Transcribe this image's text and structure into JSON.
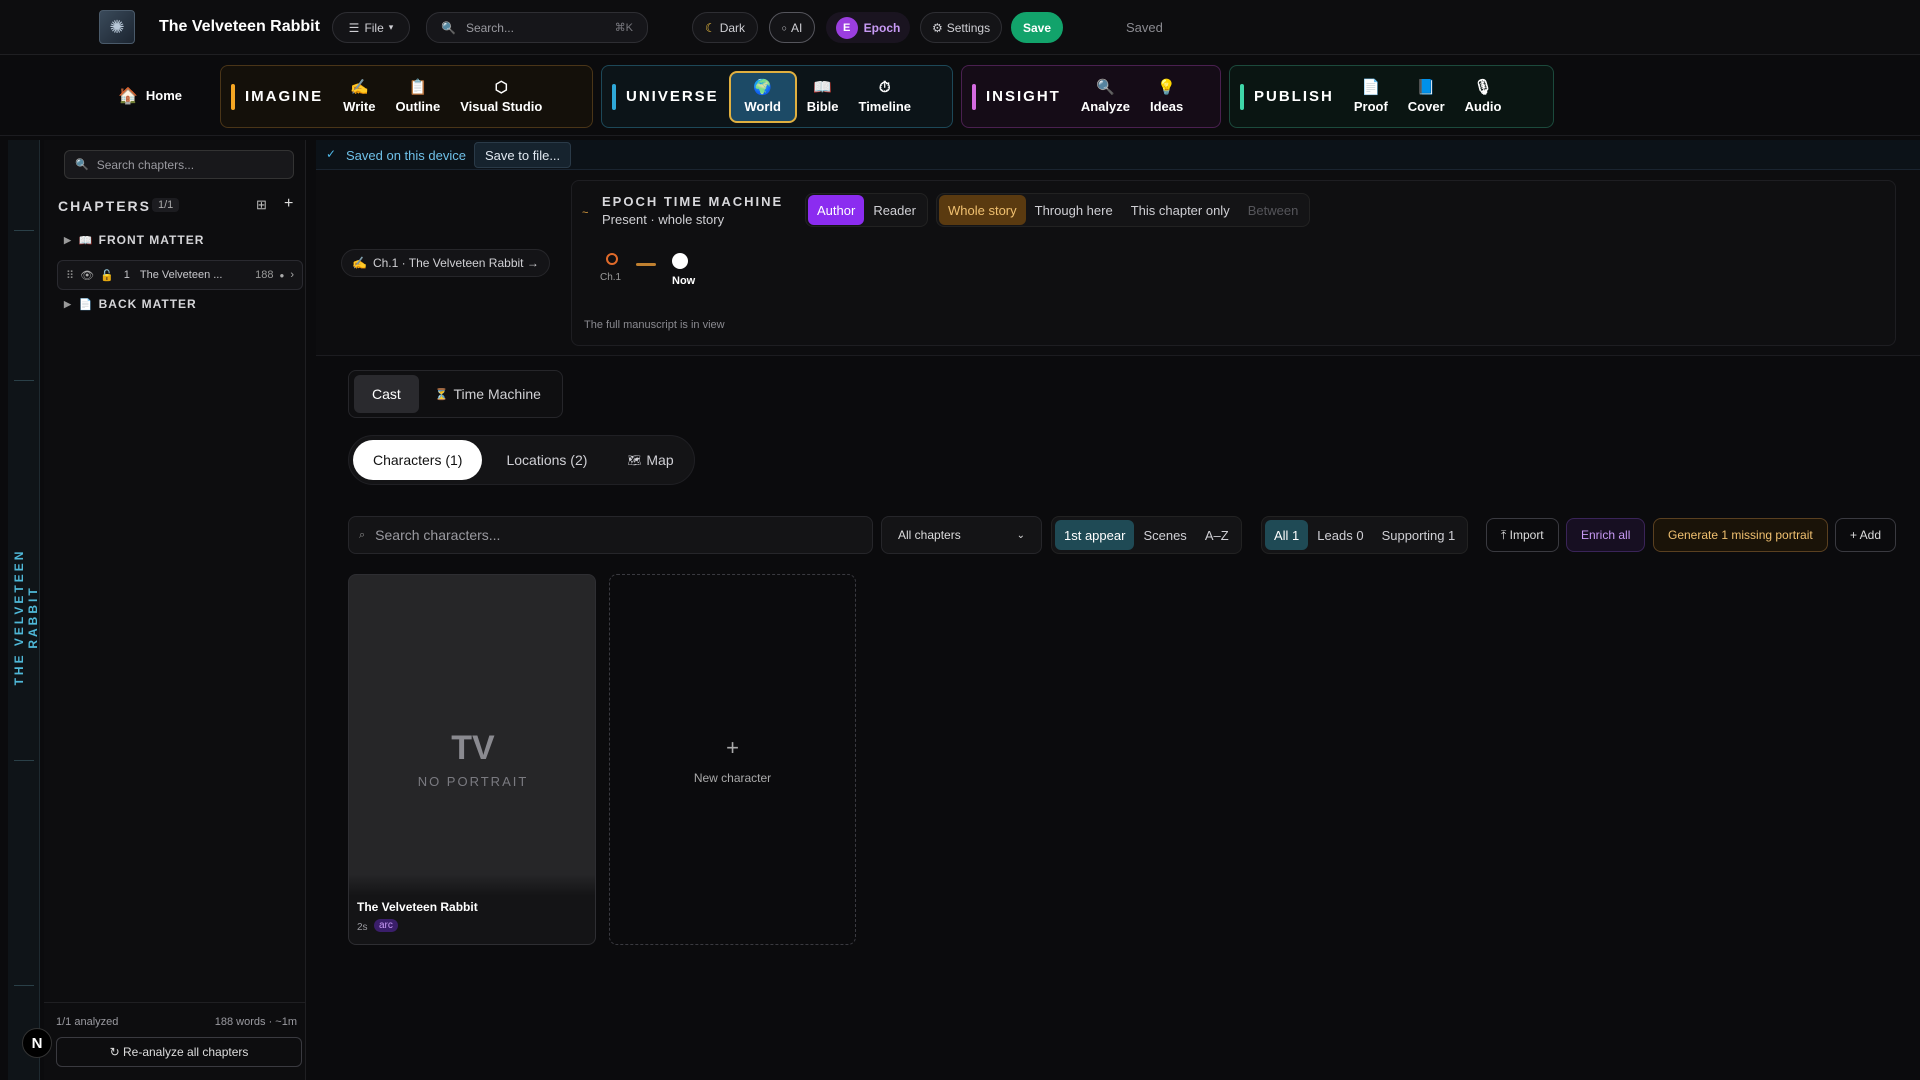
{
  "topbar": {
    "title": "The Velveteen Rabbit",
    "file_label": "File",
    "search_placeholder": "Search...",
    "search_shortcut": "⌘K",
    "dark_label": "Dark",
    "ai_label": "AI",
    "epoch_badge": "E",
    "epoch_label": "Epoch",
    "settings_label": "Settings",
    "save_label": "Save",
    "status": "Saved"
  },
  "nav": {
    "home": "Home",
    "groups": [
      {
        "name": "IMAGINE",
        "color": "#f5a623",
        "items": [
          {
            "icon": "✍",
            "label": "Write"
          },
          {
            "icon": "📋",
            "label": "Outline"
          },
          {
            "icon": "⬡",
            "label": "Visual Studio"
          }
        ]
      },
      {
        "name": "UNIVERSE",
        "color": "#2fa8d8",
        "items": [
          {
            "icon": "🌍",
            "label": "World"
          },
          {
            "icon": "📖",
            "label": "Bible"
          },
          {
            "icon": "⏱",
            "label": "Timeline"
          }
        ]
      },
      {
        "name": "INSIGHT",
        "color": "#d46be0",
        "items": [
          {
            "icon": "🔍",
            "label": "Analyze"
          },
          {
            "icon": "💡",
            "label": "Ideas"
          }
        ]
      },
      {
        "name": "PUBLISH",
        "color": "#3fd6a8",
        "items": [
          {
            "icon": "📄",
            "label": "Proof"
          },
          {
            "icon": "📘",
            "label": "Cover"
          },
          {
            "icon": "🎙",
            "label": "Audio"
          }
        ]
      }
    ]
  },
  "rail": {
    "label": "THE VELVETEEN RABBIT"
  },
  "sidebar": {
    "search_placeholder": "Search chapters...",
    "chapters_title": "CHAPTERS",
    "chapters_count": "1/1",
    "front_matter": "FRONT MATTER",
    "chapter": {
      "number": "1",
      "title": "The Velveteen ...",
      "words": "188"
    },
    "back_matter": "BACK MATTER",
    "analyzed": "1/1 analyzed",
    "words_time": "188 words · ~1m",
    "reanalyze": "↻ Re-analyze all chapters",
    "avatar": "N"
  },
  "savebar": {
    "saved_text": "Saved on this device",
    "save_to_file": "Save to file..."
  },
  "time_machine": {
    "chapter_chip": "Ch.1 · The Velveteen Rabbit →",
    "title": "EPOCH TIME MACHINE",
    "subtitle": "Present · whole story",
    "modes": [
      "Author",
      "Reader"
    ],
    "ranges": [
      "Whole story",
      "Through here",
      "This chapter only",
      "Between"
    ],
    "timeline_start": "Ch.1",
    "timeline_now": "Now",
    "footer": "The full manuscript is in view"
  },
  "tabs": {
    "cast": "Cast",
    "time_machine": "Time Machine"
  },
  "subtabs": {
    "characters": "Characters (1)",
    "locations": "Locations (2)",
    "map": "Map"
  },
  "toolbar": {
    "search_placeholder": "Search characters...",
    "chapter_select": "All chapters",
    "sort": [
      "1st appear",
      "Scenes",
      "A–Z"
    ],
    "filters": [
      "All 1",
      "Leads 0",
      "Supporting 1"
    ],
    "import": "⤒ Import",
    "enrich": "Enrich all",
    "generate": "Generate 1 missing portrait",
    "add": "+ Add"
  },
  "cards": {
    "character": {
      "initials": "TV",
      "no_portrait": "NO PORTRAIT",
      "name": "The Velveteen Rabbit",
      "scenes": "2s",
      "tag": "arc"
    },
    "new": {
      "plus": "+",
      "label": "New character"
    }
  }
}
